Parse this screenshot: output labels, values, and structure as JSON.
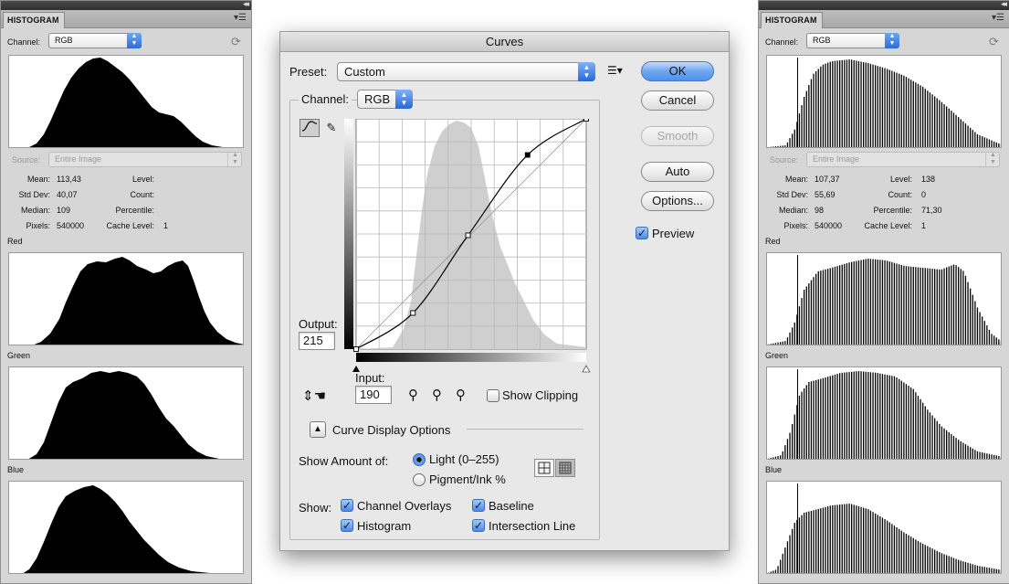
{
  "histogram_left": {
    "tab": "HISTOGRAM",
    "channel_label": "Channel:",
    "channel_value": "RGB",
    "source_label": "Source:",
    "source_value": "Entire Image",
    "stats": {
      "mean_label": "Mean:",
      "mean": "113,43",
      "stddev_label": "Std Dev:",
      "stddev": "40,07",
      "median_label": "Median:",
      "median": "109",
      "pixels_label": "Pixels:",
      "pixels": "540000",
      "level_label": "Level:",
      "level": "",
      "count_label": "Count:",
      "count": "",
      "percentile_label": "Percentile:",
      "percentile": "",
      "cache_label": "Cache Level:",
      "cache": "1"
    },
    "labels": {
      "red": "Red",
      "green": "Green",
      "blue": "Blue"
    }
  },
  "histogram_right": {
    "tab": "HISTOGRAM",
    "channel_label": "Channel:",
    "channel_value": "RGB",
    "source_label": "Source:",
    "source_value": "Entire Image",
    "stats": {
      "mean_label": "Mean:",
      "mean": "107,37",
      "stddev_label": "Std Dev:",
      "stddev": "55,69",
      "median_label": "Median:",
      "median": "98",
      "pixels_label": "Pixels:",
      "pixels": "540000",
      "level_label": "Level:",
      "level": "138",
      "count_label": "Count:",
      "count": "0",
      "percentile_label": "Percentile:",
      "percentile": "71,30",
      "cache_label": "Cache Level:",
      "cache": "1"
    },
    "labels": {
      "red": "Red",
      "green": "Green",
      "blue": "Blue"
    }
  },
  "curves": {
    "title": "Curves",
    "preset_label": "Preset:",
    "preset_value": "Custom",
    "channel_label": "Channel:",
    "channel_value": "RGB",
    "output_label": "Output:",
    "output_value": "215",
    "input_label": "Input:",
    "input_value": "190",
    "show_clipping": "Show Clipping",
    "curve_display_options": "Curve Display Options",
    "show_amount_label": "Show Amount of:",
    "light_option": "Light  (0–255)",
    "pigment_option": "Pigment/Ink %",
    "show_label": "Show:",
    "channel_overlays": "Channel Overlays",
    "baseline": "Baseline",
    "histogram": "Histogram",
    "intersection_line": "Intersection Line",
    "preview": "Preview",
    "buttons": {
      "ok": "OK",
      "cancel": "Cancel",
      "smooth": "Smooth",
      "auto": "Auto",
      "options": "Options..."
    },
    "curve_points": [
      [
        0,
        0
      ],
      [
        63,
        40
      ],
      [
        124,
        126
      ],
      [
        190,
        215
      ],
      [
        255,
        255
      ]
    ],
    "selected_point": [
      190,
      215
    ]
  },
  "icons": [
    "refresh-icon",
    "panel-menu-icon",
    "curve-tool-icon",
    "pencil-tool-icon",
    "on-image-adjust-icon",
    "black-eyedropper-icon",
    "gray-eyedropper-icon",
    "white-eyedropper-icon",
    "preset-options-icon",
    "grid-simple-icon",
    "grid-detailed-icon"
  ]
}
